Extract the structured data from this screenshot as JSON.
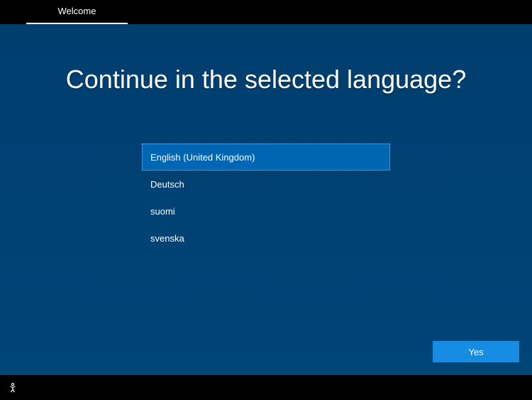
{
  "header": {
    "tab_label": "Welcome"
  },
  "main": {
    "heading": "Continue in the selected language?",
    "languages": [
      {
        "label": "English (United Kingdom)",
        "selected": true
      },
      {
        "label": "Deutsch",
        "selected": false
      },
      {
        "label": "suomi",
        "selected": false
      },
      {
        "label": "svenska",
        "selected": false
      }
    ],
    "yes_button": "Yes"
  }
}
